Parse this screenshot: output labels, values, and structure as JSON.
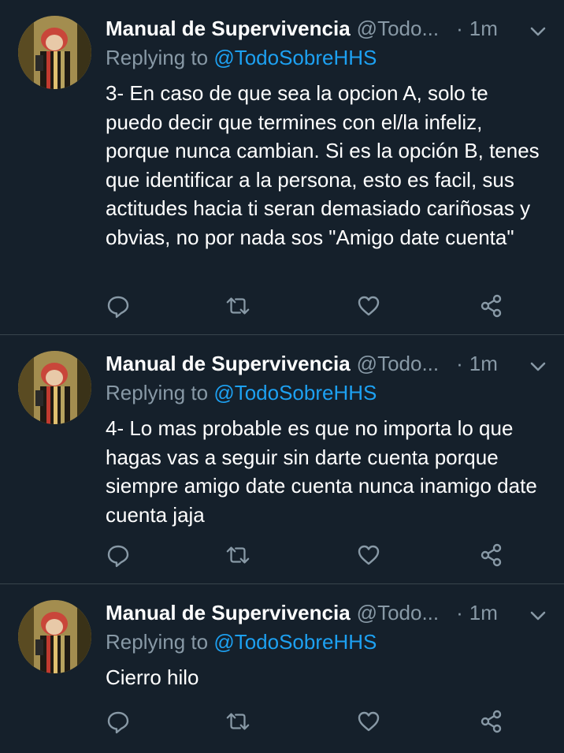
{
  "tweets": [
    {
      "author_name": "Manual de Supervivencia",
      "handle": "@Todo...",
      "separator": "·",
      "time": "1m",
      "replying_prefix": "Replying to",
      "replying_to": "@TodoSobreHHS",
      "text": "3- En caso de que sea la opcion A, solo te puedo decir que termines con el/la infeliz, porque nunca cambian. Si es la opción B, tenes que identificar a la persona, esto es facil, sus actitudes hacia ti seran demasiado cariñosas y obvias, no por nada sos \"Amigo date cuenta\""
    },
    {
      "author_name": "Manual de Supervivencia",
      "handle": "@Todo...",
      "separator": "·",
      "time": "1m",
      "replying_prefix": "Replying to",
      "replying_to": "@TodoSobreHHS",
      "text": "4- Lo mas probable es que no importa lo que hagas vas a seguir sin darte cuenta porque siempre amigo date cuenta nunca inamigo date cuenta jaja"
    },
    {
      "author_name": "Manual de Supervivencia",
      "handle": "@Todo...",
      "separator": "·",
      "time": "1m",
      "replying_prefix": "Replying to",
      "replying_to": "@TodoSobreHHS",
      "text": "Cierro hilo"
    }
  ],
  "icons": {
    "reply": "reply-icon",
    "retweet": "retweet-icon",
    "like": "heart-icon",
    "share": "share-icon",
    "menu": "chevron-down-icon"
  },
  "colors": {
    "background": "#15202b",
    "secondary_text": "#8899a6",
    "link": "#1da1f2",
    "divider": "#38444d"
  }
}
